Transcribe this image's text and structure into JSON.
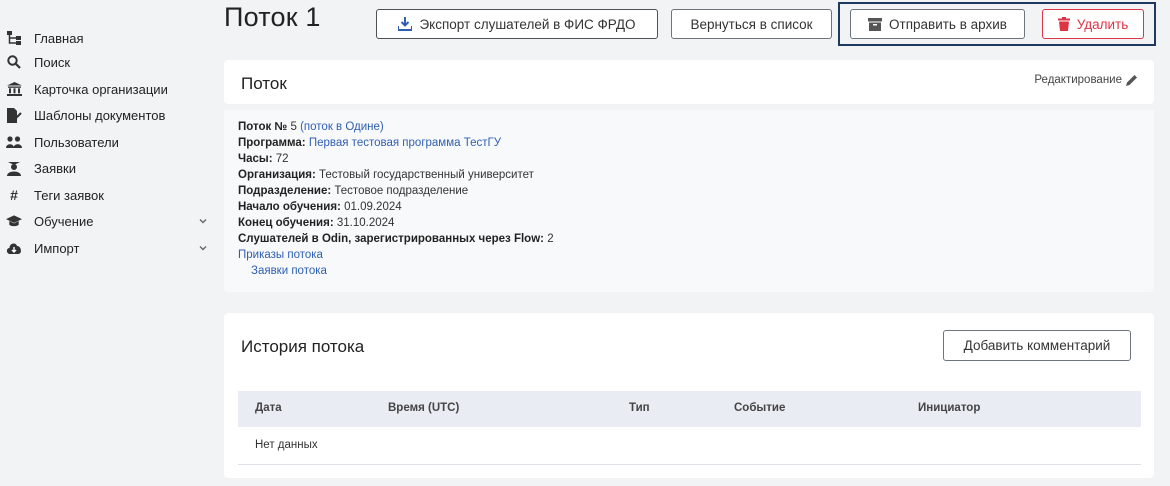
{
  "sidebar": {
    "items": [
      {
        "label": "Главная",
        "icon": "sitemap-icon",
        "expandable": false
      },
      {
        "label": "Поиск",
        "icon": "search-icon",
        "expandable": false
      },
      {
        "label": "Карточка организации",
        "icon": "university-icon",
        "expandable": false
      },
      {
        "label": "Шаблоны документов",
        "icon": "file-signature-icon",
        "expandable": false
      },
      {
        "label": "Пользователи",
        "icon": "users-icon",
        "expandable": false
      },
      {
        "label": "Заявки",
        "icon": "user-graduate-icon",
        "expandable": false
      },
      {
        "label": "Теги заявок",
        "icon": "hashtag-icon",
        "expandable": false
      },
      {
        "label": "Обучение",
        "icon": "graduation-cap-icon",
        "expandable": true
      },
      {
        "label": "Импорт",
        "icon": "cloud-download-icon",
        "expandable": true
      }
    ]
  },
  "header": {
    "title": "Поток 1",
    "export_label": "Экспорт слушателей в ФИС ФРДО",
    "back_label": "Вернуться в список",
    "archive_label": "Отправить в архив",
    "delete_label": "Удалить"
  },
  "flow_card": {
    "title": "Поток",
    "edit_label": "Редактирование",
    "fields": {
      "number_label": "Поток №",
      "number_value": "5",
      "odin_link": "(поток в Одине)",
      "program_label": "Программа:",
      "program_value": "Первая тестовая программа ТестГУ",
      "hours_label": "Часы:",
      "hours_value": "72",
      "org_label": "Организация:",
      "org_value": "Тестовый государственный университет",
      "dept_label": "Подразделение:",
      "dept_value": "Тестовое подразделение",
      "start_label": "Начало обучения:",
      "start_value": "01.09.2024",
      "end_label": "Конец обучения:",
      "end_value": "31.10.2024",
      "students_label": "Слушателей в Odin, зарегистрированных через Flow:",
      "students_value": "2"
    },
    "orders_link": "Приказы потока",
    "requests_link": "Заявки потока"
  },
  "history_card": {
    "title": "История потока",
    "add_comment_label": "Добавить комментарий",
    "columns": [
      "Дата",
      "Время (UTC)",
      "Тип",
      "Событие",
      "Инициатор"
    ],
    "empty_text": "Нет данных"
  },
  "colors": {
    "accent_link": "#2f5fb3",
    "danger": "#dc3545",
    "focus_frame": "#1f3a5f",
    "page_bg": "#f2f3f5"
  }
}
